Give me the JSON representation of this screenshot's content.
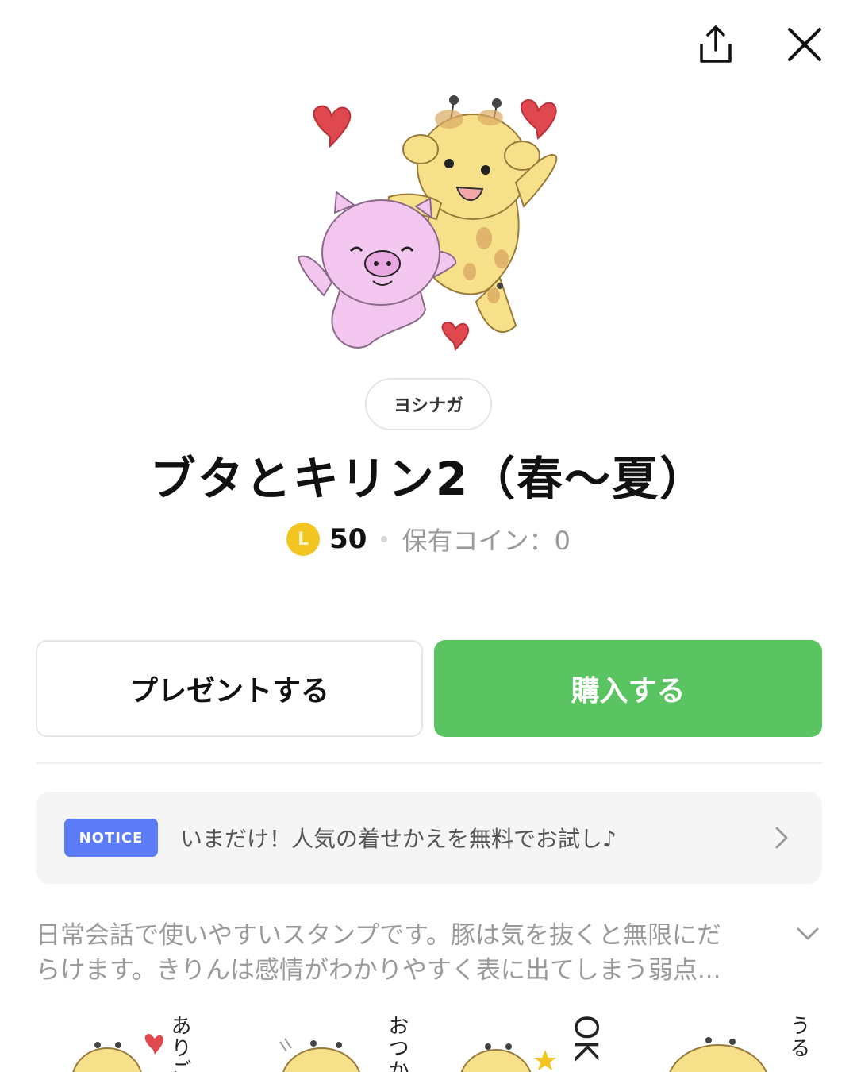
{
  "header": {
    "share_icon": "share-icon",
    "close_icon": "close-icon"
  },
  "product": {
    "author": "ヨシナガ",
    "title": "ブタとキリン2（春〜夏）",
    "coin_letter": "L",
    "price": "50",
    "owned_coins": "保有コイン：0"
  },
  "actions": {
    "gift_label": "プレゼントする",
    "buy_label": "購入する"
  },
  "notice": {
    "badge": "NOTICE",
    "text": "いまだけ！人気の着せかえを無料でお試し♪"
  },
  "description": {
    "line1": "日常会話で使いやすいスタンプです。豚は気を抜くと無限にだ",
    "line2": "らけます。きりんは感情がわかりやすく表に出てしまう弱点..."
  },
  "stickers": [
    {
      "text": "ありご"
    },
    {
      "text": "おつか"
    },
    {
      "text": "OK"
    },
    {
      "text": "うる"
    }
  ],
  "colors": {
    "buy_button": "#5ac463",
    "notice_badge": "#5b7cf6",
    "coin": "#f2c521",
    "heart": "#e0484f",
    "pig": "#f3c6ef",
    "giraffe": "#f7e08a"
  }
}
